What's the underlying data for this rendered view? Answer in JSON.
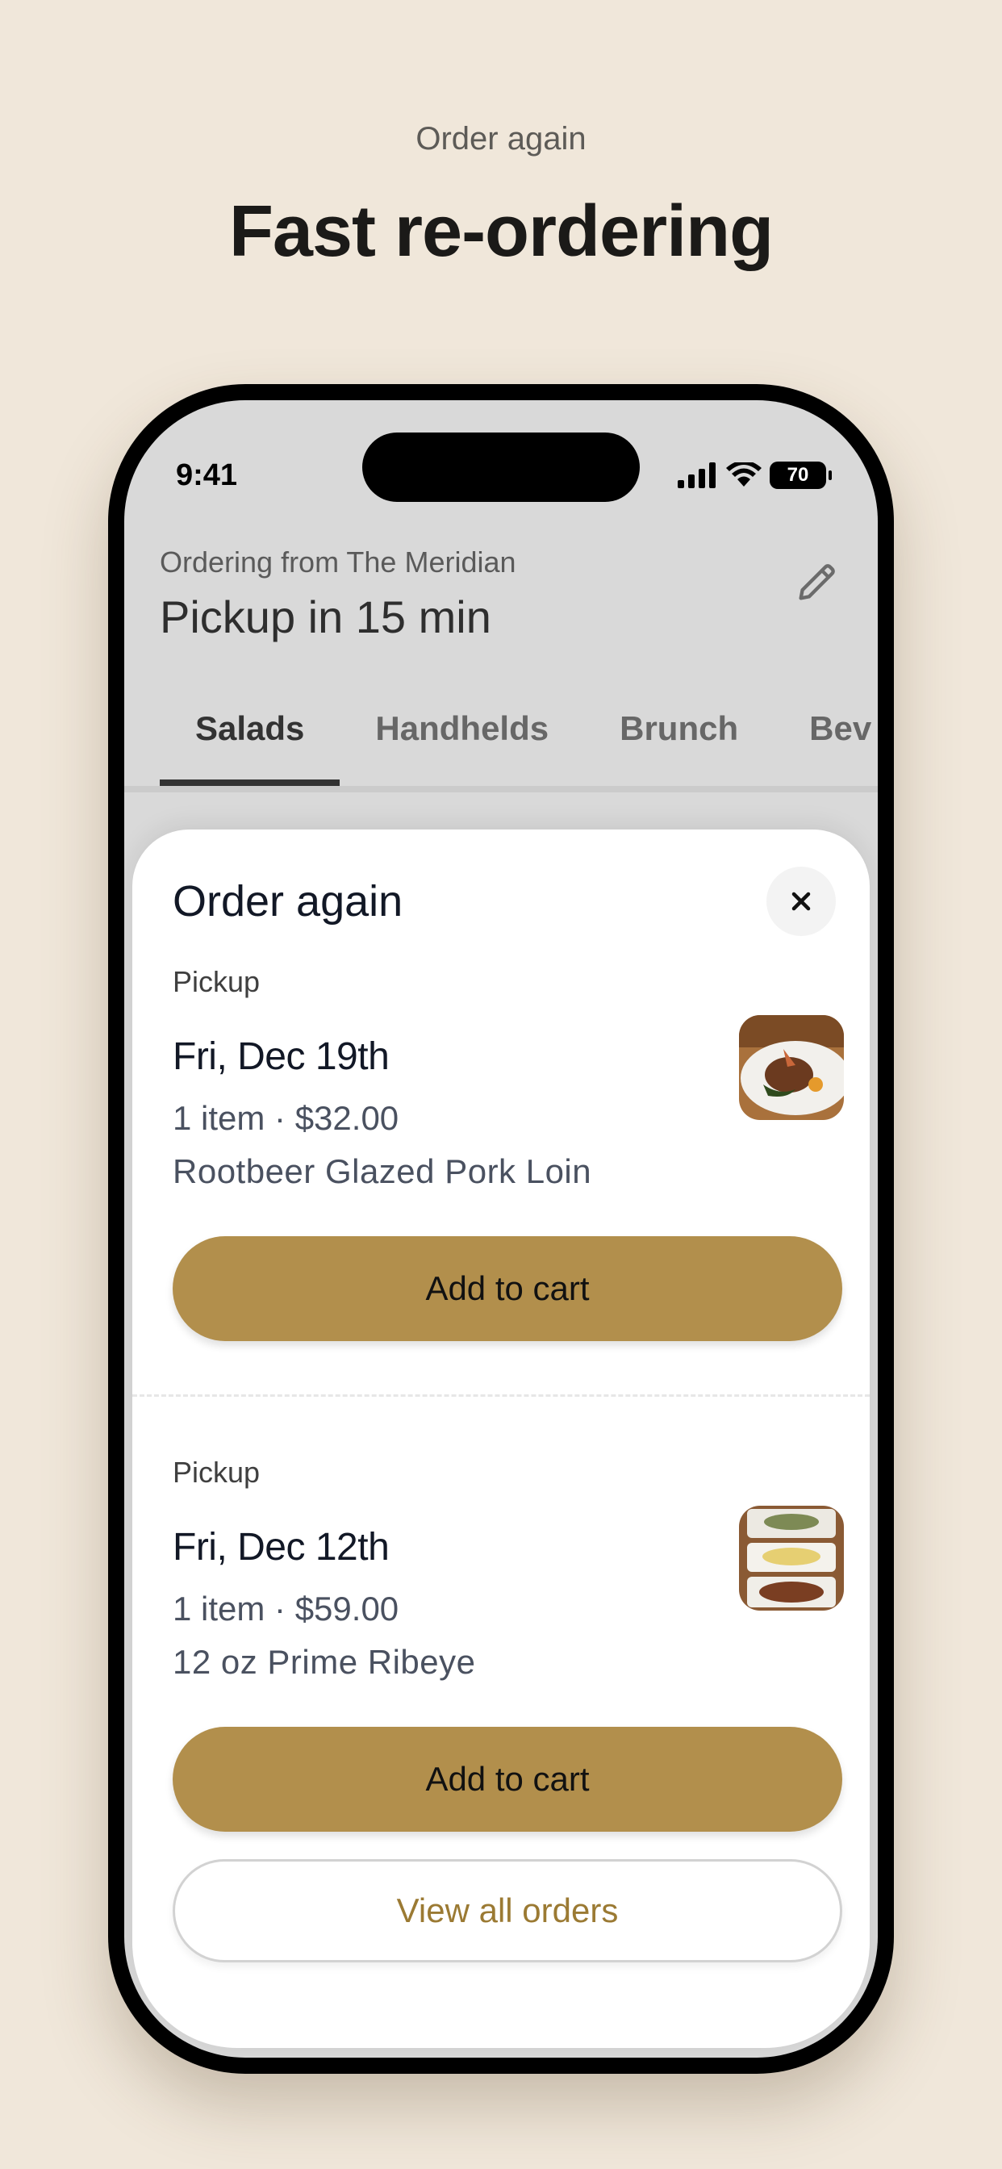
{
  "promo": {
    "eyebrow": "Order again",
    "title": "Fast re-ordering"
  },
  "status_bar": {
    "time": "9:41",
    "battery": "70",
    "icons": [
      "signal-icon",
      "wifi-icon",
      "battery-icon"
    ]
  },
  "header": {
    "subtitle": "Ordering from The Meridian",
    "title": "Pickup in 15 min",
    "edit_icon": "pencil-icon"
  },
  "tabs": [
    {
      "label": "Salads",
      "active": true
    },
    {
      "label": "Handhelds",
      "active": false
    },
    {
      "label": "Brunch",
      "active": false
    },
    {
      "label": "Bev",
      "active": false
    }
  ],
  "sheet": {
    "title": "Order again",
    "close_icon": "close-icon",
    "orders": [
      {
        "type": "Pickup",
        "date": "Fri, Dec 19th",
        "summary": "1 item · $32.00",
        "item": "Rootbeer Glazed Pork Loin",
        "button": "Add to cart"
      },
      {
        "type": "Pickup",
        "date": "Fri, Dec 12th",
        "summary": "1 item · $59.00",
        "item": "12 oz Prime Ribeye",
        "button": "Add to cart"
      }
    ],
    "view_all": "View all orders"
  },
  "colors": {
    "background": "#f0e7da",
    "accent": "#b28f4c",
    "accent_text": "#9b7a33"
  }
}
